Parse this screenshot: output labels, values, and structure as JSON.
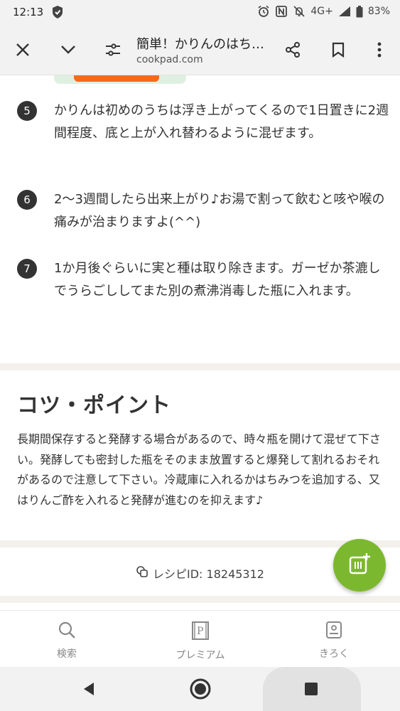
{
  "status_bar": {
    "time": "12:13",
    "network": "4G+",
    "battery": "83%"
  },
  "toolbar": {
    "title": "簡単！かりんのはち…",
    "url": "cookpad.com"
  },
  "steps": [
    {
      "number": "5",
      "text": "かりんは初めのうちは浮き上がってくるので1日置きに2週間程度、底と上が入れ替わるように混ぜます。"
    },
    {
      "number": "6",
      "text": "2〜3週間したら出来上がり♪お湯で割って飲むと咳や喉の痛みが治まりますよ(^^)"
    },
    {
      "number": "7",
      "text": "1か月後ぐらいに実と種は取り除きます。ガーゼか茶漉しでうらごししてまた別の煮沸消毒した瓶に入れます。"
    }
  ],
  "tips": {
    "heading": "コツ・ポイント",
    "body": "長期間保存すると発酵する場合があるので、時々瓶を開けて混ぜて下さい。発酵しても密封した瓶をそのまま放置すると爆発して割れるおそれがあるので注意して下さい。冷蔵庫に入れるかはちみつを追加する、又はりんご酢を入れると発酵が進むのを抑えます♪"
  },
  "recipe_id": {
    "label": "レシピID: 18245312"
  },
  "bottom_nav": {
    "items": [
      {
        "label": "検索",
        "icon": "search-icon"
      },
      {
        "label": "プレミアム",
        "icon": "premium-icon"
      },
      {
        "label": "きろく",
        "icon": "record-icon"
      }
    ]
  },
  "colors": {
    "accent": "#7cb82f",
    "step_badge": "#333333",
    "separator": "#f4f1ec"
  }
}
